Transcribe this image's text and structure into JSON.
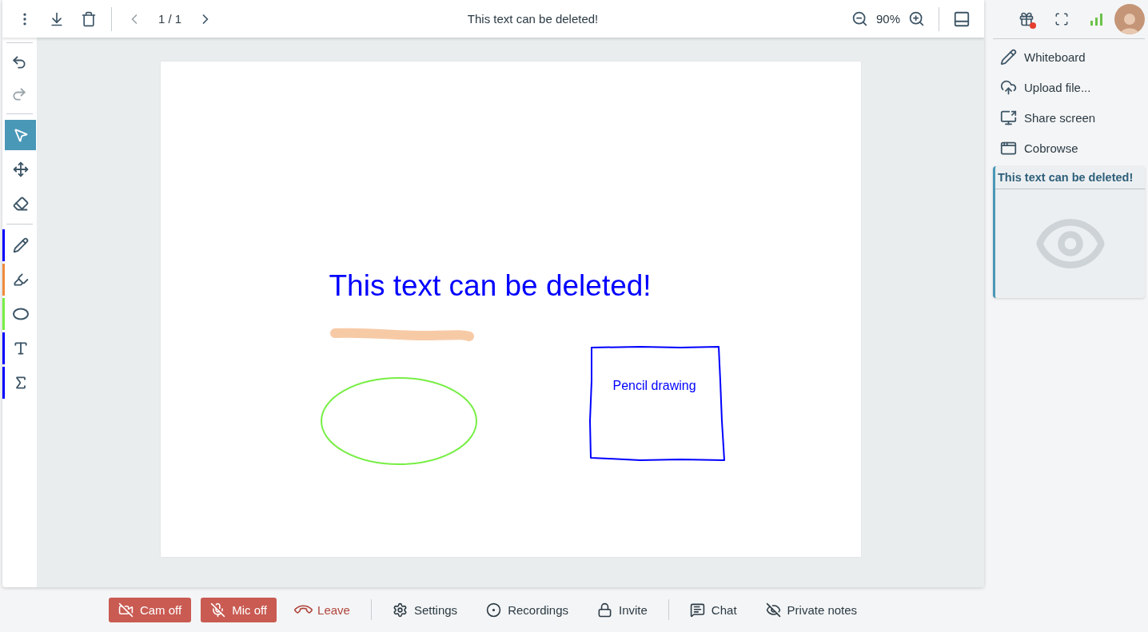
{
  "toolbar": {
    "page_indicator": "1 / 1",
    "title": "This text can be deleted!",
    "zoom": "90%"
  },
  "history": [
    {
      "kind": "undo",
      "disabled": false
    },
    {
      "kind": "redo",
      "disabled": true
    }
  ],
  "tools": [
    {
      "kind": "pointer",
      "selected": true
    },
    {
      "kind": "move",
      "selected": false
    },
    {
      "kind": "eraser",
      "selected": false
    },
    {
      "kind": "pencil",
      "selected": false,
      "color": "#0000ff"
    },
    {
      "kind": "highlighter",
      "selected": false,
      "color": "#f08a3c"
    },
    {
      "kind": "ellipse",
      "selected": false,
      "color": "#77ee44"
    },
    {
      "kind": "text",
      "selected": false,
      "color": "#0000ff"
    },
    {
      "kind": "formula",
      "selected": false,
      "color": "#0000ff"
    }
  ],
  "canvas_objects": [
    {
      "kind": "text",
      "text": "This text can be deleted!",
      "color": "#0000ff"
    },
    {
      "kind": "highlight",
      "color": "#f7caa6"
    },
    {
      "kind": "ellipse",
      "color": "#77ee44"
    },
    {
      "kind": "rectangle",
      "color": "#0000ff",
      "label": "Pencil drawing"
    }
  ],
  "sidebar": {
    "notification": true,
    "menu": [
      {
        "kind": "pencil",
        "label": "Whiteboard"
      },
      {
        "kind": "upload",
        "label": "Upload file..."
      },
      {
        "kind": "share",
        "label": "Share screen"
      },
      {
        "kind": "cobrowse",
        "label": "Cobrowse"
      }
    ],
    "pages": [
      {
        "title": "This text can be deleted!",
        "selected": true
      }
    ]
  },
  "call_controls": [
    [
      {
        "label": "Cam off",
        "kind": "danger"
      },
      {
        "label": "Mic off",
        "kind": "danger"
      },
      {
        "label": "Leave",
        "kind": "leave"
      }
    ],
    [
      {
        "label": "Settings",
        "kind": "plain"
      },
      {
        "label": "Recordings",
        "kind": "plain"
      },
      {
        "label": "Invite",
        "kind": "plain"
      }
    ],
    [
      {
        "label": "Chat",
        "kind": "plain"
      },
      {
        "label": "Private notes",
        "kind": "plain"
      }
    ]
  ]
}
